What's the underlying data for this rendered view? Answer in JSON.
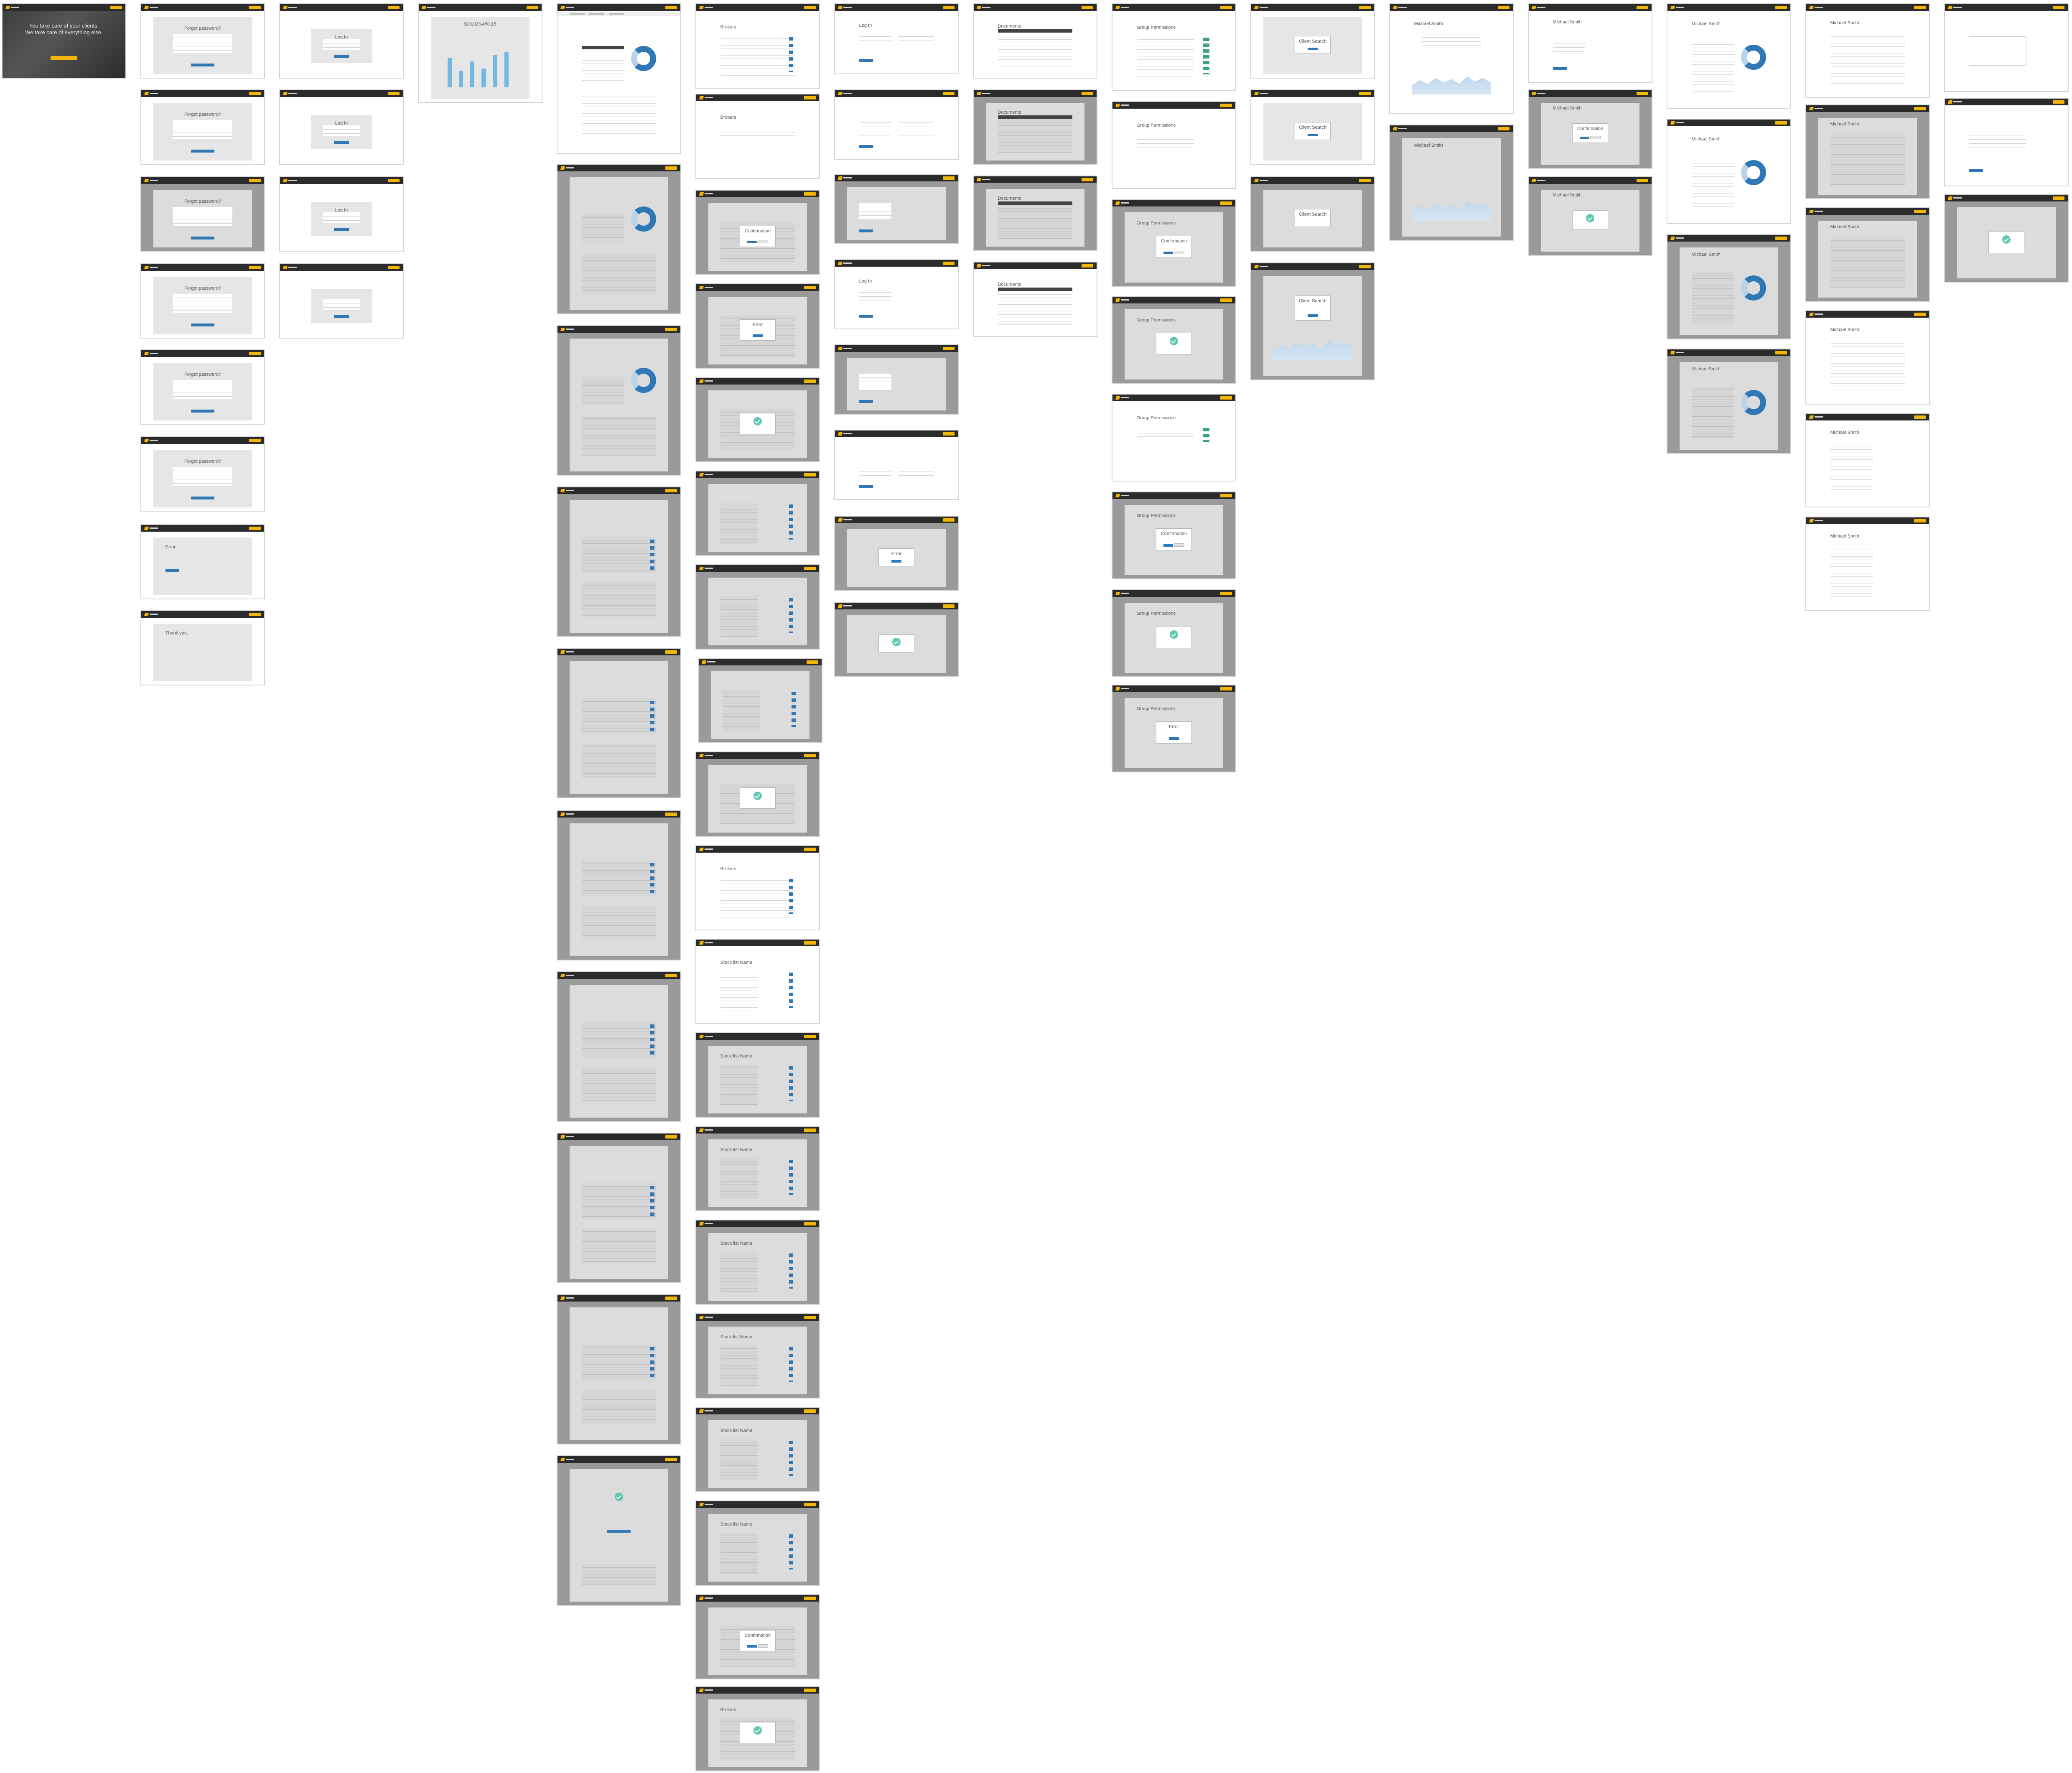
{
  "board": {
    "background": "#ffffff"
  },
  "colors": {
    "brand": "#f2b705",
    "primary": "#2f78b5",
    "topbar": "#2b2b2b",
    "success": "#5fc7b4"
  },
  "hero": {
    "headline_1": "You take care of your clients.",
    "headline_2": "We take care of everything else."
  },
  "titles": {
    "forgot": "Forgot password?",
    "login": "Log In",
    "error": "Error",
    "thanks": "Thank you.",
    "confirmation": "Confirmation",
    "brokers": "Brokers",
    "documents": "Documents",
    "group_permissions": "Group Permissions",
    "client_search": "Client Search",
    "profile": "Michael Smith",
    "stock_list": "Stock list Name"
  },
  "dashboard": {
    "amount": "$10,023,450.15"
  },
  "frames": [
    {
      "id": "f1",
      "kind": "hero"
    },
    {
      "id": "f2",
      "kind": "form",
      "title": "forgot"
    },
    {
      "id": "f3",
      "kind": "login",
      "title": "login"
    },
    {
      "id": "f4",
      "kind": "bars",
      "title": ""
    },
    {
      "id": "f5",
      "kind": "donut"
    },
    {
      "id": "f6",
      "kind": "brokers",
      "title": "brokers"
    },
    {
      "id": "f7",
      "kind": "form",
      "title": "login"
    },
    {
      "id": "f8",
      "kind": "table",
      "title": "documents"
    },
    {
      "id": "f9",
      "kind": "table",
      "title": "group_permissions"
    },
    {
      "id": "f10",
      "kind": "modal",
      "title": "client_search"
    },
    {
      "id": "f11",
      "kind": "area",
      "title": "profile"
    },
    {
      "id": "f12",
      "kind": "form",
      "title": "profile"
    },
    {
      "id": "f13",
      "kind": "donut",
      "title": "profile"
    },
    {
      "id": "f14",
      "kind": "table",
      "title": "profile"
    },
    {
      "id": "f15",
      "kind": "form"
    }
  ]
}
